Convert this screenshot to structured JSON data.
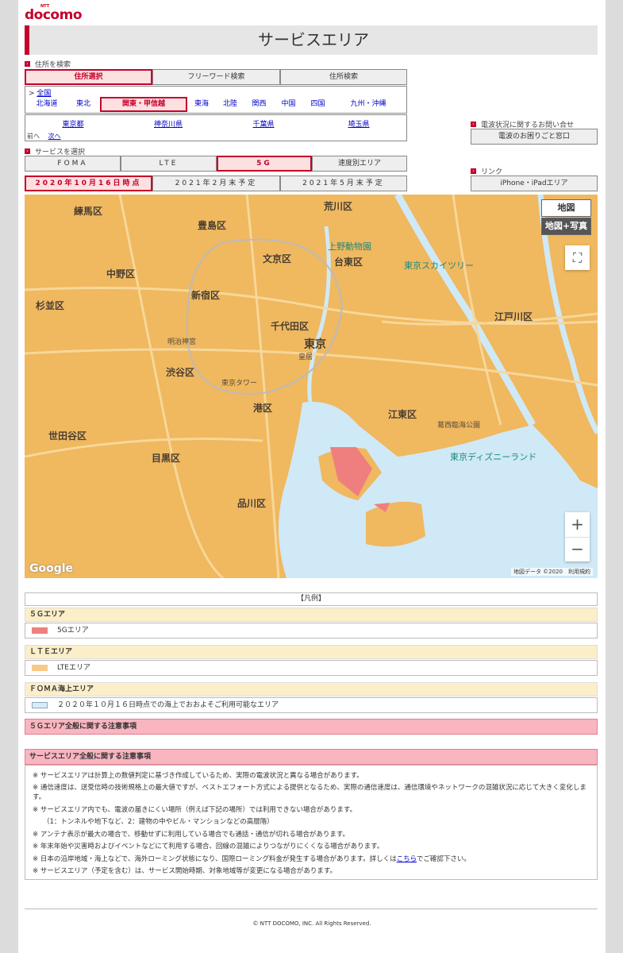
{
  "brand": {
    "ntt": "NTT",
    "name": "docomo"
  },
  "page_title": "サービスエリア",
  "address_section": {
    "label": "住所を検索",
    "tabs": [
      "住所選択",
      "フリーワード検索",
      "住所検索"
    ],
    "all_prefix": ">",
    "all_link": "全国",
    "regions": [
      "北海道",
      "東北",
      "関東・甲信越",
      "東海",
      "北陸",
      "関西",
      "中国",
      "四国",
      "九州・沖縄"
    ],
    "prefectures": [
      "東京都",
      "神奈川県",
      "千葉県",
      "埼玉県"
    ],
    "prev": "前へ",
    "next": "次へ"
  },
  "service_section": {
    "label": "サービスを選択",
    "tabs": [
      "FOMA",
      "LTE",
      "5G",
      "速度別エリア"
    ],
    "dates": [
      "2020年10月16日時点",
      "2021年2月末予定",
      "2021年5月末予定"
    ]
  },
  "side": {
    "inquiry_label": "電波状況に関するお問い合せ",
    "inquiry_button": "電波のお困りごと窓口",
    "link_label": "リンク",
    "link_button": "iPhone・iPadエリア"
  },
  "map": {
    "type_map": "地図",
    "type_satellite": "地図+写真",
    "zoom_in": "+",
    "zoom_out": "−",
    "google": "Google",
    "copyright": "地図データ ©2020　利用規約",
    "labels": [
      "荒川区",
      "練馬区",
      "豊島区",
      "文京区",
      "台東区",
      "中野区",
      "新宿区",
      "杉並区",
      "千代田区",
      "東京",
      "江戸川区",
      "渋谷区",
      "港区",
      "江東区",
      "世田谷区",
      "目黒区",
      "品川区",
      "上野動物園",
      "東京スカイツリー",
      "東京ディズニーランド",
      "明治神宮",
      "東京タワー",
      "皇居",
      "葛西臨海公園"
    ]
  },
  "legend": {
    "title": "【凡例】",
    "g5_title": "５Ｇエリア",
    "g5_item": "5Gエリア",
    "lte_title": "ＬＴＥエリア",
    "lte_item": "LTEエリア",
    "foma_title": "ＦＯＭＡ海上エリア",
    "foma_item": "２０２０年１０月１６日時点での海上でおおよそご利用可能なエリア",
    "colors": {
      "g5": "#f08080",
      "lte": "#f7c98a",
      "foma": "#d6eefa"
    }
  },
  "notice_5g": "５Ｇエリア全般に関する注意事項",
  "notice_general": {
    "title": "サービスエリア全般に関する注意事項",
    "items": [
      "※ サービスエリアは計算上の数値判定に基づき作成しているため、実際の電波状況と異なる場合があります。",
      "※ 通信速度は、送受信時の技術規格上の最大値ですが、ベストエフォート方式による提供となるため、実際の通信速度は、通信環境やネットワークの混雑状況に応じて大きく変化します。",
      "※ サービスエリア内でも、電波の届きにくい場所（例えば下記の場所）では利用できない場合があります。",
      "（1：トンネルや地下など、2：建物の中やビル・マンションなどの高層階）",
      "※ アンテナ表示が最大の場合で、移動せずに利用している場合でも通話・通信が切れる場合があります。",
      "※ 年末年始や災害時およびイベントなどにて利用する場合、回線の混雑によりつながりにくくなる場合があります。",
      "※ 日本の沿岸地域・海上などで、海外ローミング状態になり、国際ローミング料金が発生する場合があります。詳しくは",
      "※ サービスエリア（予定を含む）は、サービス開始時期、対象地域等が変更になる場合があります。"
    ],
    "link_text": "こちら",
    "link_suffix": "でご確認下さい。"
  },
  "footer": "© NTT DOCOMO, INC. All Rights Reserved."
}
